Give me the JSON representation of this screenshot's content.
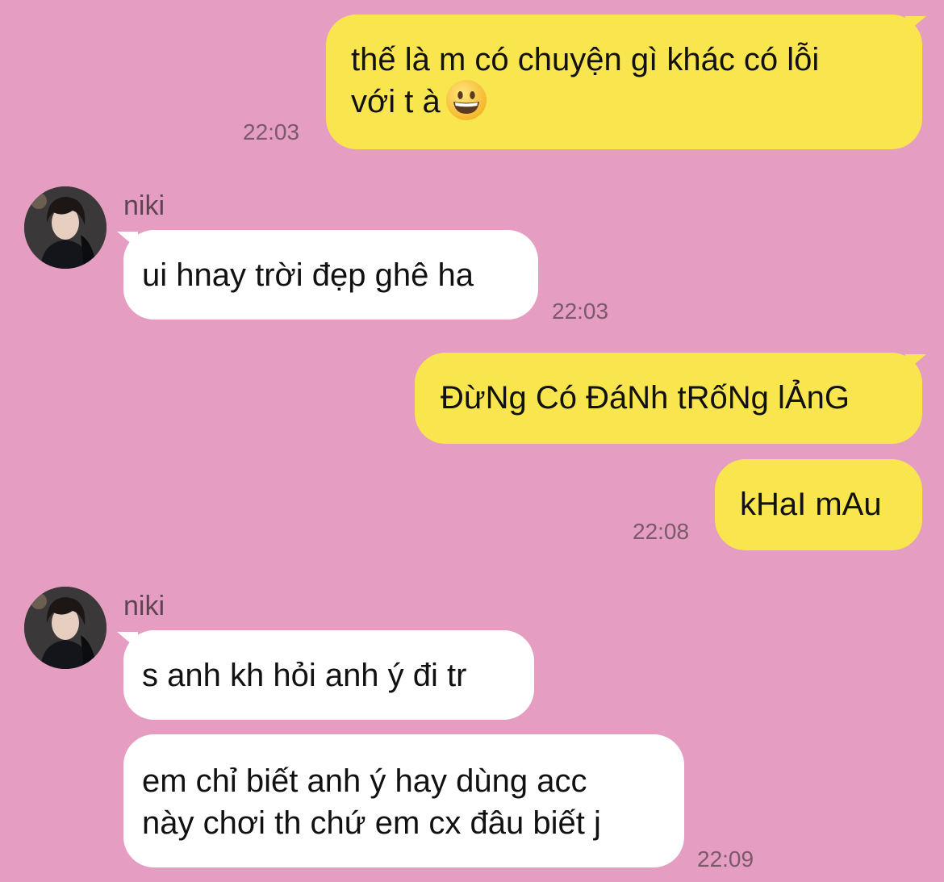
{
  "contact": {
    "name": "niki"
  },
  "messages": [
    {
      "direction": "outgoing",
      "text_line1": "thế là m có chuyện gì khác có lỗi",
      "text_line2": "với t à",
      "emoji": "grinning-face",
      "time": "22:03"
    },
    {
      "direction": "incoming",
      "sender": "niki",
      "text": "ui hnay trời đẹp ghê ha",
      "time": "22:03"
    },
    {
      "direction": "outgoing",
      "text": "ĐừNg Có ĐáNh tRốNg lẢnG"
    },
    {
      "direction": "outgoing",
      "text": "kHaI mAu",
      "time": "22:08"
    },
    {
      "direction": "incoming",
      "sender": "niki",
      "text": "s anh kh hỏi anh ý đi tr"
    },
    {
      "direction": "incoming",
      "text_line1": "em chỉ biết anh ý hay dùng acc",
      "text_line2": "này chơi th chứ em cx đâu biết j",
      "time": "22:09"
    }
  ],
  "colors": {
    "background": "#E59EC1",
    "outgoing_bubble": "#F9E54E",
    "incoming_bubble": "#FFFFFF",
    "timestamp": "#7A5A6A",
    "sender_name": "#5E4452"
  }
}
